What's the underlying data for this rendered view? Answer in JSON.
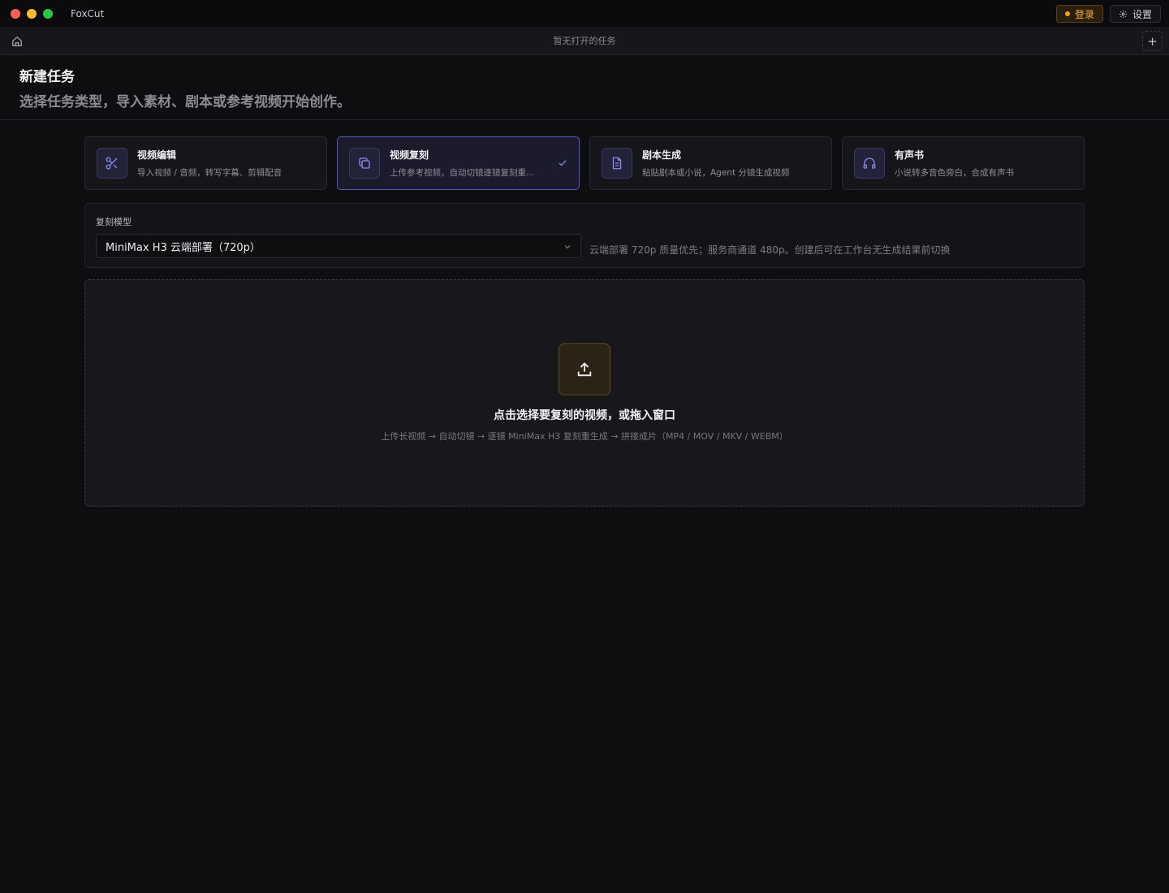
{
  "window": {
    "app_name": "FoxCut"
  },
  "titlebar": {
    "login_label": "登录",
    "settings_label": "设置"
  },
  "tabbar": {
    "empty_text": "暂无打开的任务",
    "add_label": "+"
  },
  "header": {
    "title": "新建任务",
    "subtitle": "选择任务类型，导入素材、剧本或参考视频开始创作。"
  },
  "cards": [
    {
      "title": "视频编辑",
      "desc": "导入视频 / 音频，转写字幕、剪辑配音",
      "icon": "scissors-icon",
      "active": false
    },
    {
      "title": "视频复刻",
      "desc": "上传参考视频，自动切镜逐镜复刻重...",
      "icon": "copy-icon",
      "active": true
    },
    {
      "title": "剧本生成",
      "desc": "粘贴剧本或小说，Agent 分镜生成视频",
      "icon": "document-icon",
      "active": false
    },
    {
      "title": "有声书",
      "desc": "小说转多音色旁白，合成有声书",
      "icon": "headphones-icon",
      "active": false
    }
  ],
  "model": {
    "label": "复刻模型",
    "selected": "MiniMax H3 云端部署（720p）",
    "hint": "云端部署 720p 质量优先；服务商通道 480p。创建后可在工作台无生成结果前切换"
  },
  "dropzone": {
    "title": "点击选择要复刻的视频，或拖入窗口",
    "subtitle": "上传长视频 → 自动切镜 → 逐镜 MiniMax H3 复刻重生成 → 拼接成片（MP4 / MOV / MKV / WEBM）"
  },
  "colors": {
    "accent": "#5658c4",
    "warning": "#f2b43c",
    "background": "#0e0e11"
  }
}
